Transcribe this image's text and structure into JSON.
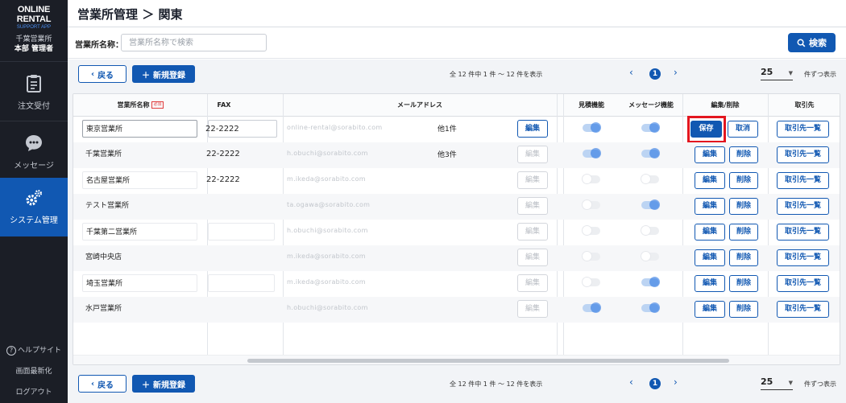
{
  "sidebar": {
    "logo_main": "ONLINE RENTAL",
    "logo_sub": "SUPPORT APP",
    "user_org": "千葉営業所",
    "user_name": "本部 管理者",
    "nav": [
      {
        "label": "注文受付",
        "icon": "order-clipboard-icon"
      },
      {
        "label": "メッセージ",
        "icon": "chat-bubble-icon"
      },
      {
        "label": "システム管理",
        "icon": "gears-icon"
      }
    ],
    "help_label": "ヘルプサイト",
    "refresh_label": "画面最新化",
    "logout_label": "ログアウト",
    "active_color": "#1158b2"
  },
  "header": {
    "title": "営業所管理 ＞ 関東"
  },
  "search": {
    "label": "営業所名称：",
    "placeholder": "営業所名称で検索",
    "button_label": "検索"
  },
  "pager": {
    "back_label": "戻る",
    "new_label": "新規登録",
    "count_text": "全 12 件中 1 件 〜 12 件を表示",
    "current_page": "1",
    "per_page": "25",
    "per_page_label": "件ずつ表示"
  },
  "table": {
    "headers": {
      "name": "営業所名称",
      "required": "必須",
      "fax": "FAX",
      "mail": "メールアドレス",
      "estimate": "見積機能",
      "message": "メッセージ機能",
      "edit_delete": "編集/削除",
      "partner": "取引先"
    },
    "buttons": {
      "edit": "編集",
      "delete": "削除",
      "save": "保存",
      "cancel": "取消",
      "partner_list": "取引先一覧"
    },
    "rows": [
      {
        "name": "東京営業所",
        "fax": "22-2222",
        "mail": "online-rental@sorabito.com",
        "extra": "他1件",
        "estimate_on": true,
        "message_on": true,
        "editing": true
      },
      {
        "name": "千葉営業所",
        "fax": "22-2222",
        "mail": "h.obuchi@sorabito.com",
        "extra": "他3件",
        "estimate_on": true,
        "message_on": true,
        "editing": false
      },
      {
        "name": "名古屋営業所",
        "fax": "22-2222",
        "mail": "m.ikeda@sorabito.com",
        "extra": "",
        "estimate_on": false,
        "message_on": false,
        "editing": false
      },
      {
        "name": "テスト営業所",
        "fax": "",
        "mail": "ta.ogawa@sorabito.com",
        "extra": "",
        "estimate_on": false,
        "message_on": true,
        "editing": false
      },
      {
        "name": "千葉第二営業所",
        "fax": "",
        "mail": "h.obuchi@sorabito.com",
        "extra": "",
        "estimate_on": false,
        "message_on": false,
        "editing": false
      },
      {
        "name": "宮崎中央店",
        "fax": "",
        "mail": "m.ikeda@sorabito.com",
        "extra": "",
        "estimate_on": false,
        "message_on": false,
        "editing": false
      },
      {
        "name": "埼玉営業所",
        "fax": "",
        "mail": "m.ikeda@sorabito.com",
        "extra": "",
        "estimate_on": false,
        "message_on": true,
        "editing": false
      },
      {
        "name": "水戸営業所",
        "fax": "",
        "mail": "h.obuchi@sorabito.com",
        "extra": "",
        "estimate_on": true,
        "message_on": true,
        "editing": false
      }
    ]
  }
}
